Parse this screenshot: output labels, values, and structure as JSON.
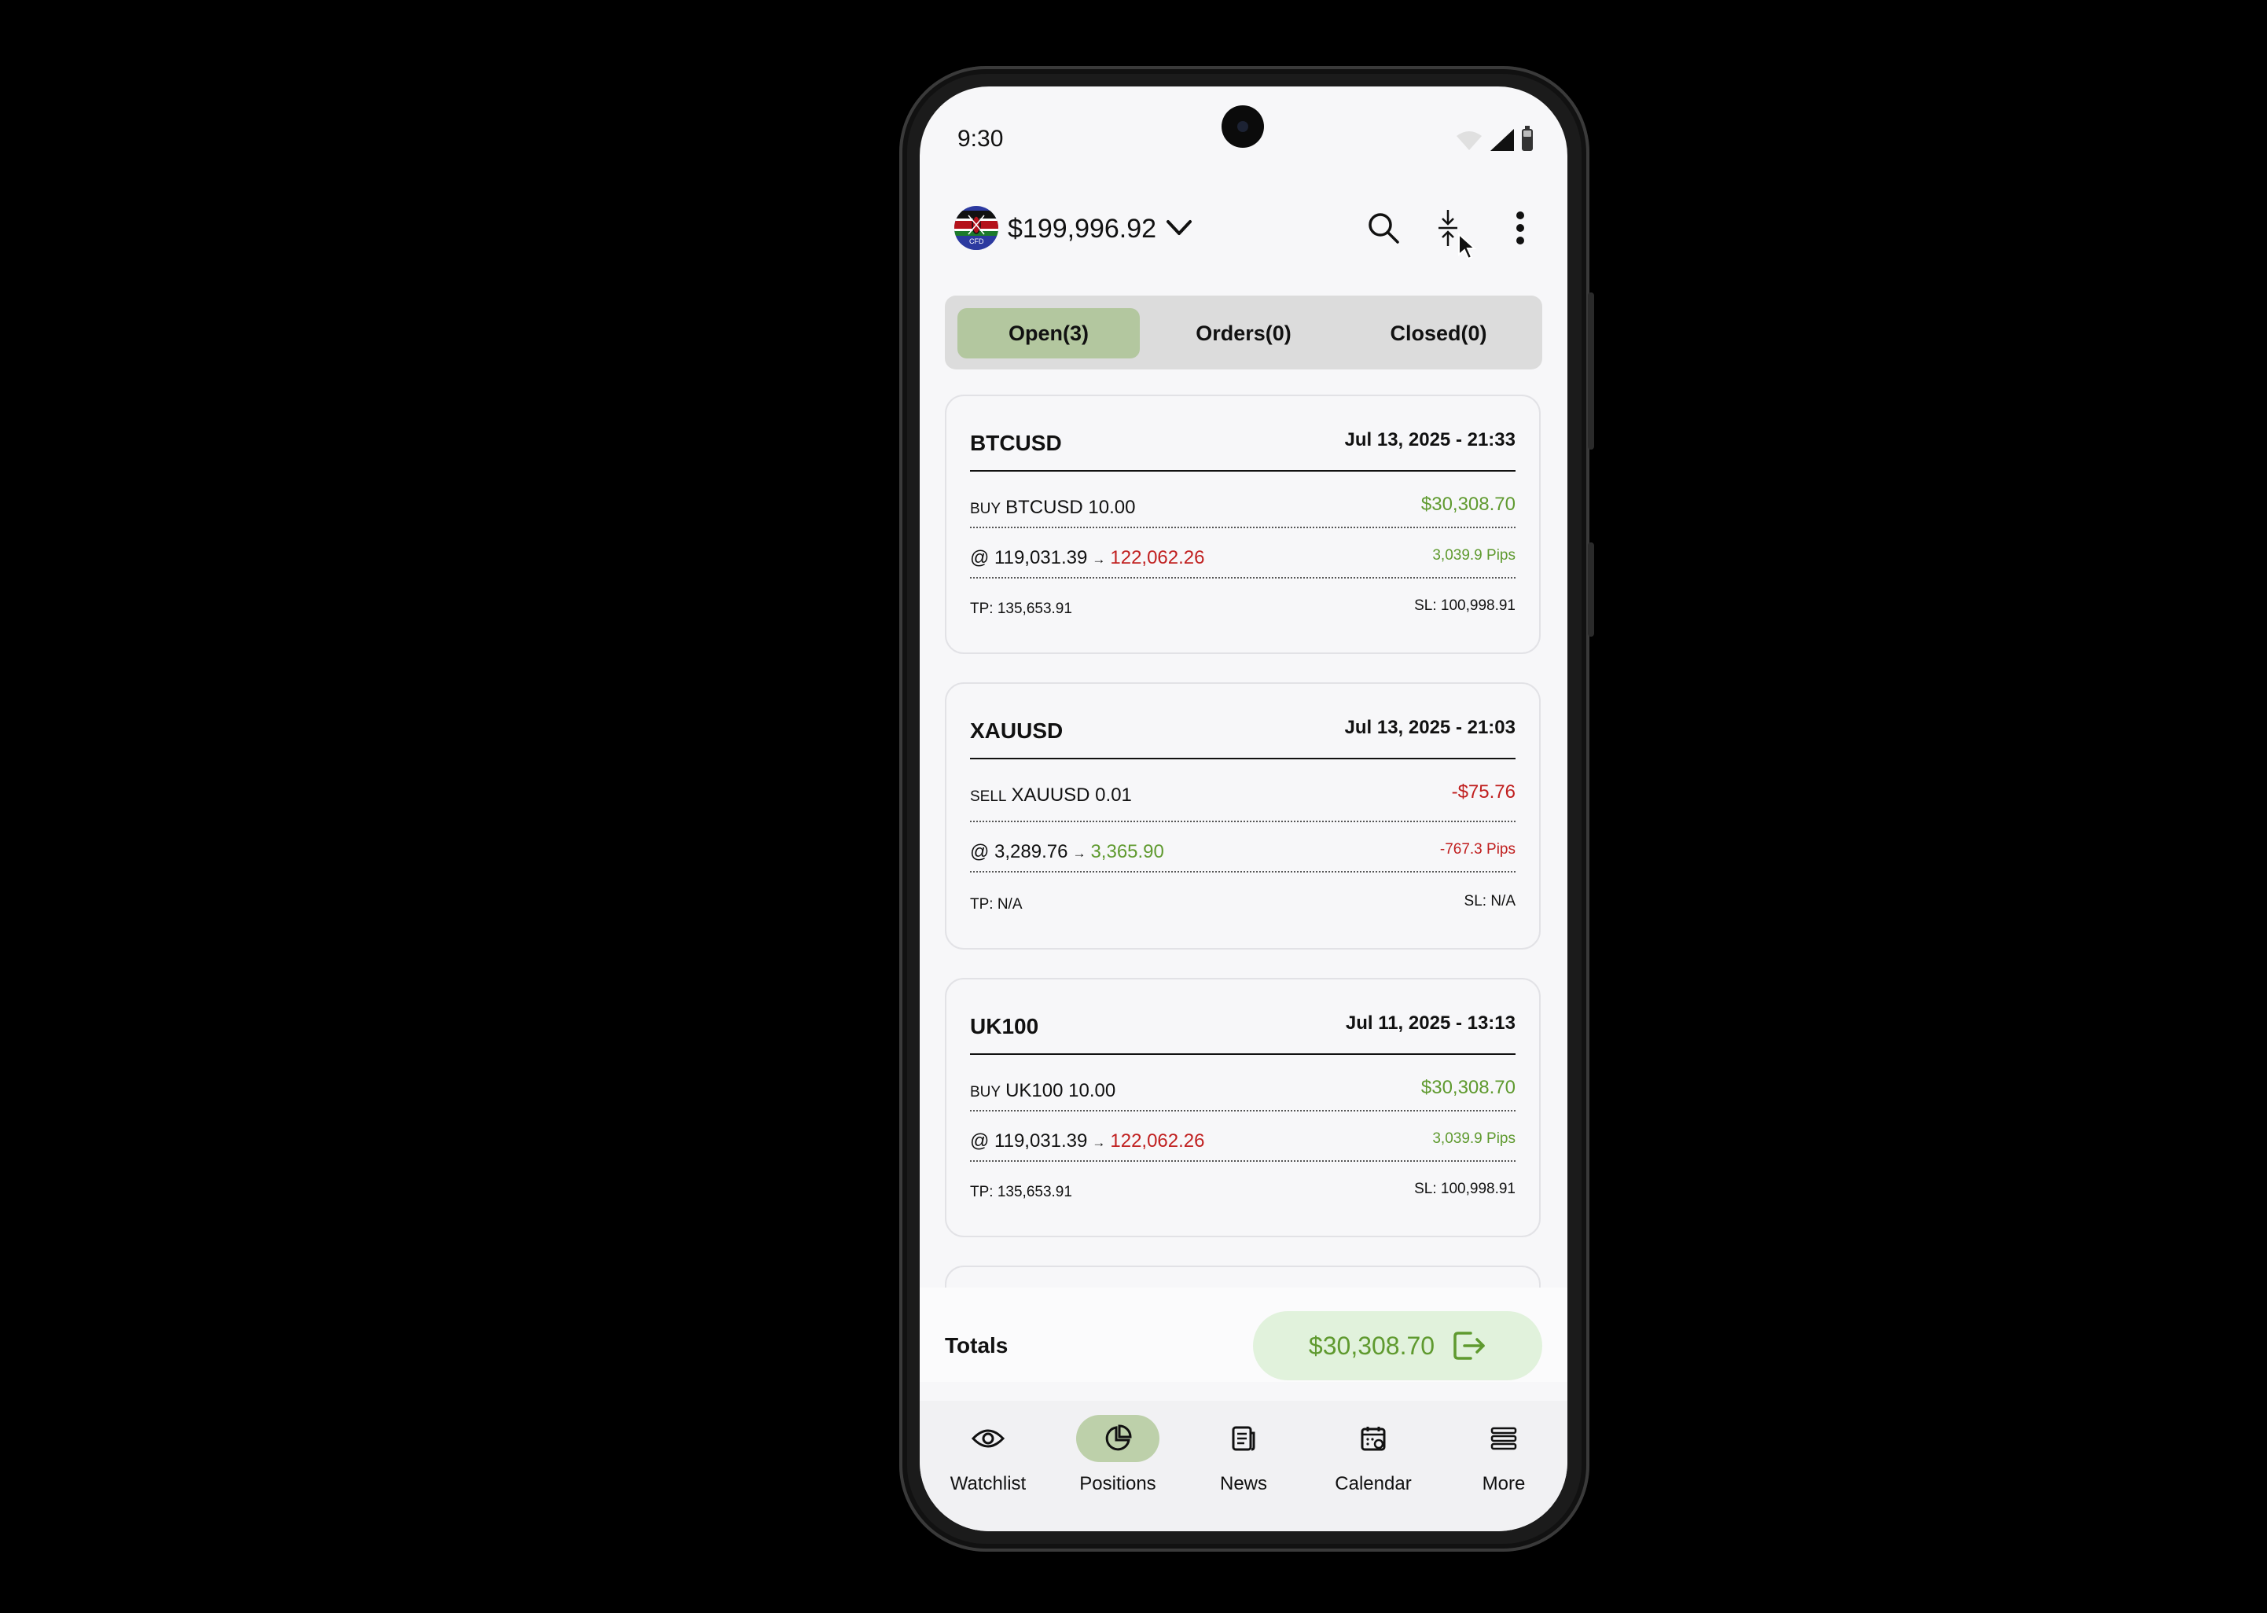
{
  "status_bar": {
    "time": "9:30"
  },
  "header": {
    "balance": "$199,996.92",
    "flag_label": "CFD"
  },
  "tabs": [
    {
      "label": "Open(3)",
      "active": true
    },
    {
      "label": "Orders(0)",
      "active": false
    },
    {
      "label": "Closed(0)",
      "active": false
    }
  ],
  "positions": [
    {
      "symbol": "BTCUSD",
      "date": "Jul 13, 2025 - 21:33",
      "side": "BUY",
      "instrument_qty": "BTCUSD 10.00",
      "pnl": "$30,308.70",
      "open_price": "@ 119,031.39",
      "arrow": "→",
      "current_price": "122,062.26",
      "pips": "3,039.9 Pips",
      "tp": "TP: 135,653.91",
      "sl": "SL: 100,998.91"
    },
    {
      "symbol": "XAUUSD",
      "date": "Jul 13, 2025 - 21:03",
      "side": "SELL",
      "instrument_qty": "XAUUSD 0.01",
      "pnl": "-$75.76",
      "open_price": "@ 3,289.76",
      "arrow": "→",
      "current_price": "3,365.90",
      "pips": "-767.3 Pips",
      "tp": "TP: N/A",
      "sl": "SL: N/A"
    },
    {
      "symbol": "UK100",
      "date": "Jul 11, 2025 - 13:13",
      "side": "BUY",
      "instrument_qty": "UK100 10.00",
      "pnl": "$30,308.70",
      "open_price": "@ 119,031.39",
      "arrow": "→",
      "current_price": "122,062.26",
      "pips": "3,039.9 Pips",
      "tp": "TP: 135,653.91",
      "sl": "SL: 100,998.91"
    }
  ],
  "totals": {
    "label": "Totals",
    "value": "$30,308.70"
  },
  "bottom_nav": [
    {
      "label": "Watchlist",
      "icon": "eye-icon"
    },
    {
      "label": "Positions",
      "icon": "pie-chart-icon",
      "active": true
    },
    {
      "label": "News",
      "icon": "newspaper-icon"
    },
    {
      "label": "Calendar",
      "icon": "calendar-icon"
    },
    {
      "label": "More",
      "icon": "menu-icon"
    }
  ],
  "colors": {
    "profit": "#5f9a2f",
    "loss": "#c01f1f",
    "active_tab": "#b3c79f",
    "totals_bg": "#e1f2dc"
  }
}
